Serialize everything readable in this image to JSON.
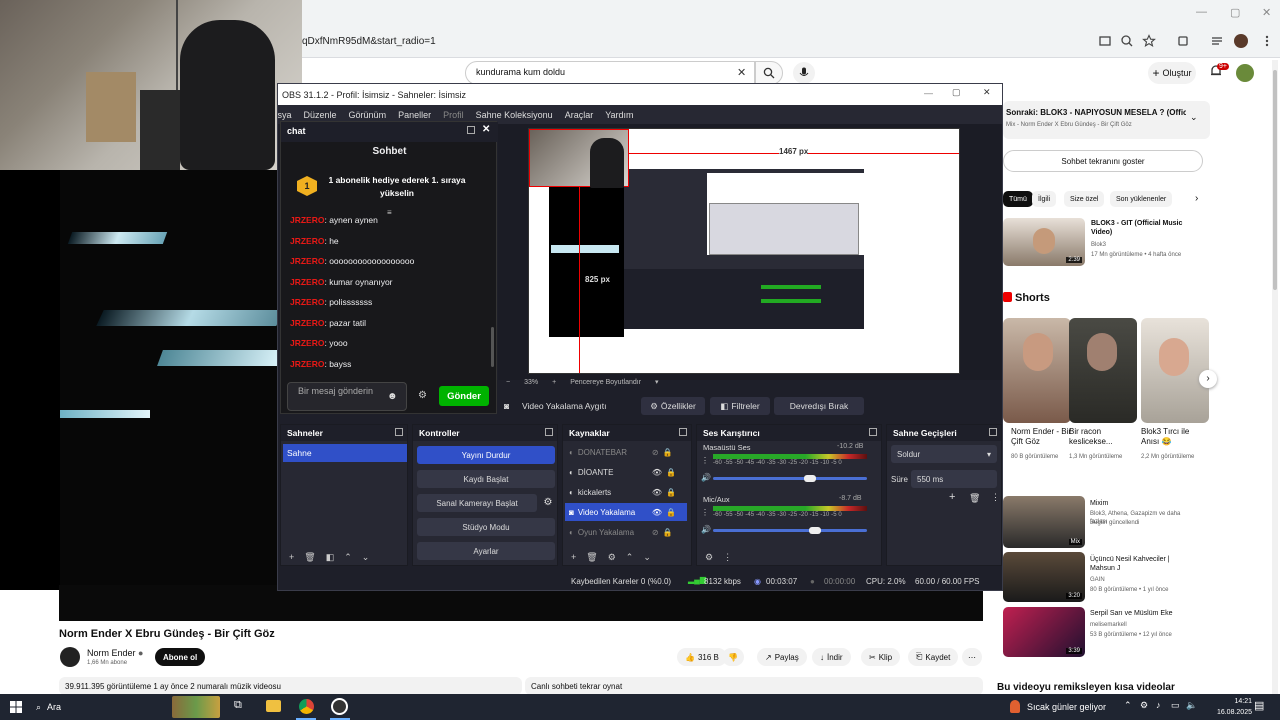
{
  "browser": {
    "url": "qDxfNmR95dM&start_radio=1"
  },
  "youtube": {
    "search_value": "kundurama kum doldu",
    "create_label": "Oluştur",
    "notif_count": "9+",
    "video": {
      "title": "Norm Ender X Ebru Gündeş - Bir Çift Göz",
      "channel": "Norm Ender",
      "subscribers": "1,66 Mn abone",
      "subscribe_label": "Abone ol",
      "likes": "316 B",
      "share_label": "Paylaş",
      "download_label": "İndir",
      "clip_label": "Klip",
      "save_label": "Kaydet",
      "description": "39.911.395 görüntüleme  1 ay önce  2 numaralı müzik videosu",
      "chat_replay": "Canlı sohbeti tekrar oynat"
    },
    "sidebar": {
      "now_playing_title": "Sonraki: BLOK3 - NAPIYOSUN MESELA ? (Official ...",
      "now_playing_sub": "Mix - Norm Ender X Ebru Gündeş - Bir Çift Göz",
      "show_chat": "Sohbet tekranını goster",
      "chips": [
        "Tümü",
        "İlgili",
        "Size özel",
        "Son yüklenenler"
      ],
      "video1": {
        "title": "BLOK3 - GIT (Official Music Video)",
        "channel": "Blok3",
        "meta": "17 Mn görüntüleme • 4 hafta önce",
        "duration": "2:39"
      },
      "shorts_title": "Shorts",
      "shorts": [
        {
          "title": "Norm Ender - Bir Çift Göz",
          "views": "80 B görüntüleme"
        },
        {
          "title": "Bir racon keslicekse...",
          "views": "1,3 Mn görüntüleme"
        },
        {
          "title": "Blok3 Tırcı ile Anısı 😂",
          "views": "2,2 Mn görüntüleme"
        }
      ],
      "mixes": [
        {
          "title": "Mixim",
          "meta": "Blok3, Athena, Gazapizm ve daha fazlası",
          "meta2": "Bugün güncellendi",
          "duration": "Mix"
        },
        {
          "title": "Üçüncü Nesil Kahveciler | Mahsun J",
          "meta": "GAIN",
          "meta2": "80 B görüntüleme • 1 yıl önce",
          "duration": "3:20"
        },
        {
          "title": "Serpil Sarı ve Müslüm Eke",
          "meta": "melisemarkell",
          "meta2": "53 B görüntüleme • 12 yıl önce",
          "duration": "3:39"
        }
      ],
      "remix_title": "Bu videoyu remiksleyen kısa videolar"
    }
  },
  "obs": {
    "title": "OBS 31.1.2 - Profil: İsimsiz - Sahneler: İsimsiz",
    "menu": [
      "Dosya",
      "Düzenle",
      "Görünüm",
      "Paneller",
      "Profil",
      "Sahne Koleksiyonu",
      "Araçlar",
      "Yardım"
    ],
    "preview": {
      "width_label": "1467 px",
      "height_label": "825 px",
      "zoom": "33%",
      "fit_label": "Pencereye Boyutlandır"
    },
    "source_bar": {
      "selected": "Video Yakalama Aygıtı",
      "properties": "Özellikler",
      "filters": "Filtreler",
      "deactivate": "Devredışı Bırak"
    },
    "docks": {
      "scenes_title": "Sahneler",
      "scenes": [
        "Sahne"
      ],
      "controls_title": "Kontroller",
      "controls": [
        "Yayını Durdur",
        "Kaydı Başlat",
        "Sanal Kamerayı Başlat",
        "Stüdyo Modu",
        "Ayarlar"
      ],
      "sources_title": "Kaynaklar",
      "sources": [
        "DONATEBAR",
        "DİOANTE",
        "kickalerts",
        "Video Yakalama",
        "Oyun Yakalama"
      ],
      "mixer_title": "Ses Karıştırıcı",
      "mixer": [
        {
          "name": "Masaüstü Ses",
          "db": "-10.2 dB"
        },
        {
          "name": "Mic/Aux",
          "db": "-8.7 dB"
        }
      ],
      "meter_scale": "-60 -55 -50 -45 -40 -35 -30 -25 -20 -15 -10 -5 0",
      "transitions_title": "Sahne Geçişleri",
      "transition": "Soldur",
      "duration_label": "Süre",
      "duration_value": "550 ms"
    },
    "status": {
      "dropped": "Kaybedilen Kareler 0 (%0.0)",
      "bitrate": "8132 kbps",
      "live_time": "00:03:07",
      "rec_time": "00:00:00",
      "cpu": "CPU: 2.0%",
      "fps": "60.00 / 60.00 FPS"
    }
  },
  "chat": {
    "panel_title": "chat",
    "title": "Sohbet",
    "pinned": "1 abonelik hediye ederek 1. sıraya yükselin",
    "pin_rank": "1",
    "messages": [
      {
        "user": "JRZERO",
        "text": ": aynen aynen"
      },
      {
        "user": "JRZERO",
        "text": ": he"
      },
      {
        "user": "JRZERO",
        "text": ": oooooooooooooooooo"
      },
      {
        "user": "JRZERO",
        "text": ": kumar oynanıyor"
      },
      {
        "user": "JRZERO",
        "text": ": polisssssss"
      },
      {
        "user": "JRZERO",
        "text": ": pazar tatil"
      },
      {
        "user": "JRZERO",
        "text": ": yooo"
      },
      {
        "user": "JRZERO",
        "text": ": bayss"
      }
    ],
    "input_placeholder": "Bir mesaj gönderin",
    "send_label": "Gönder"
  },
  "taskbar": {
    "search_label": "Ara",
    "weather": "Sıcak günler geliyor",
    "time": "14:21",
    "date": "16.08.2025"
  }
}
